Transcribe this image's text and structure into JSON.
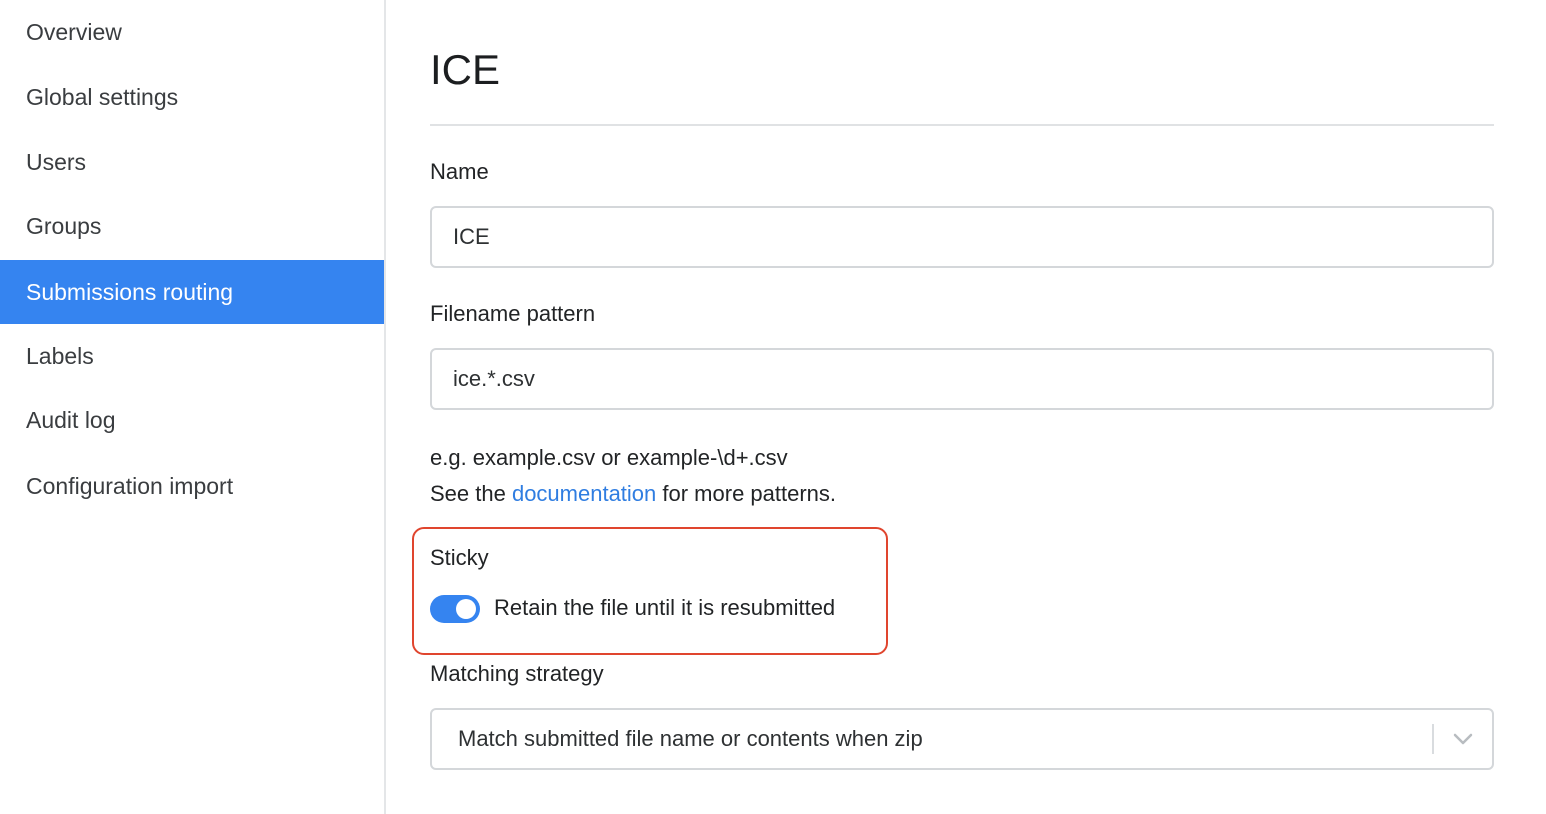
{
  "sidebar": {
    "items": [
      {
        "label": "Overview",
        "active": false
      },
      {
        "label": "Global settings",
        "active": false
      },
      {
        "label": "Users",
        "active": false
      },
      {
        "label": "Groups",
        "active": false
      },
      {
        "label": "Submissions routing",
        "active": true
      },
      {
        "label": "Labels",
        "active": false
      },
      {
        "label": "Audit log",
        "active": false
      },
      {
        "label": "Configuration import",
        "active": false
      }
    ]
  },
  "main": {
    "title": "ICE",
    "name_field": {
      "label": "Name",
      "value": "ICE"
    },
    "filename_field": {
      "label": "Filename pattern",
      "value": "ice.*.csv"
    },
    "help": {
      "example": "e.g. example.csv or example-\\d+.csv",
      "see_prefix": "See the ",
      "link_text": "documentation",
      "see_suffix": " for more patterns."
    },
    "sticky": {
      "label": "Sticky",
      "toggle_on": true,
      "toggle_label": "Retain the file until it is resubmitted"
    },
    "matching": {
      "label": "Matching strategy",
      "selected": "Match submitted file name or contents when zip"
    }
  },
  "colors": {
    "accent": "#3584f0",
    "link": "#2f7de1",
    "highlight_border": "#e0452e"
  },
  "icons": {
    "select_chevron": "chevron-down-icon"
  }
}
